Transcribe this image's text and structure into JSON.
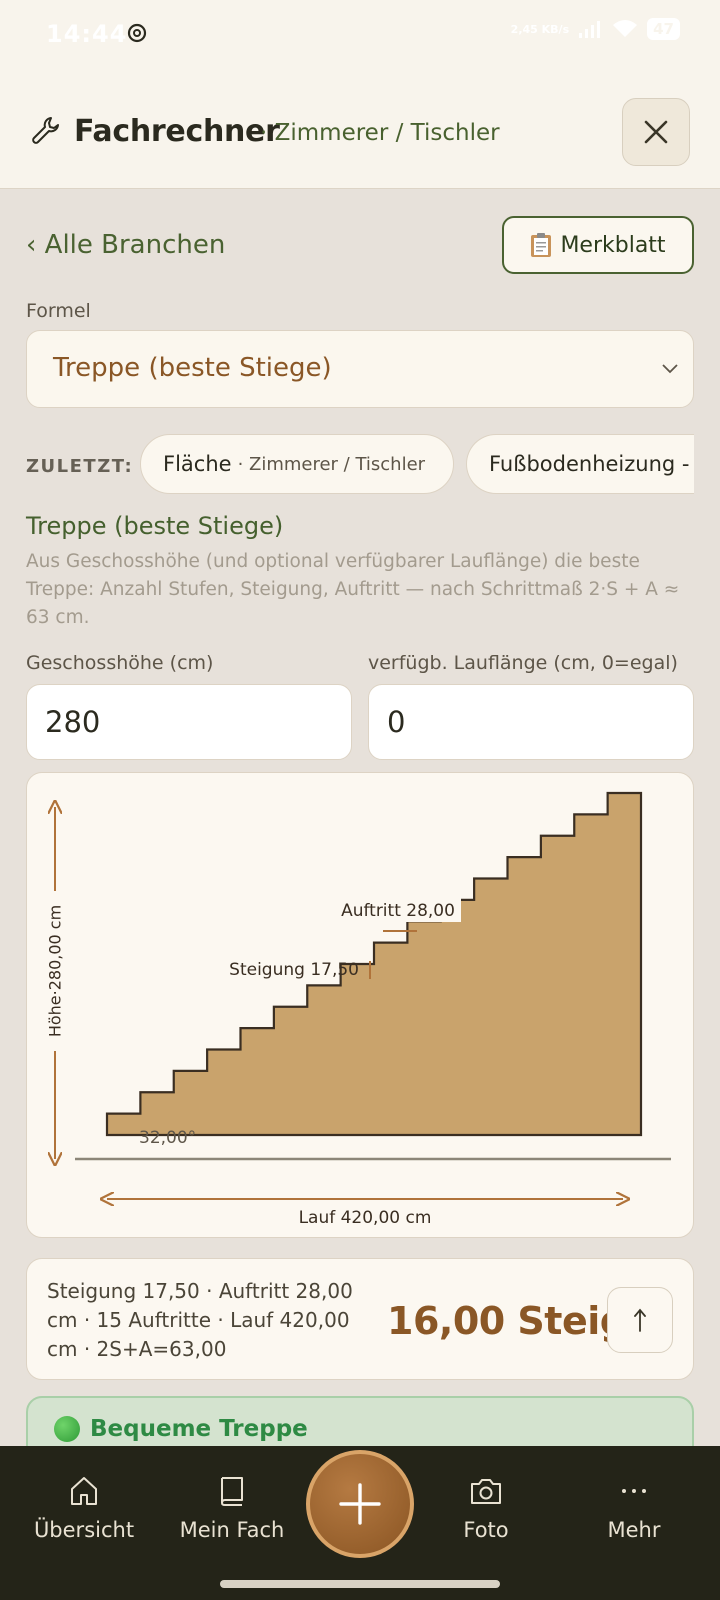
{
  "status_bar": {
    "time": "14:44",
    "net_speed": "2,45 KB/s",
    "battery": "47"
  },
  "header": {
    "title": "Fachrechner",
    "subtitle": "· Zimmerer / Tischler",
    "close_icon": "close-icon"
  },
  "nav": {
    "back_label": "‹ Alle Branchen",
    "sheet_label": "Merkblatt"
  },
  "formula": {
    "label": "Formel",
    "selected": "Treppe (beste Stiege)"
  },
  "recent": {
    "label": "ZULETZT:",
    "chips": [
      {
        "main": "Fläche",
        "sub": "· Zimmerer / Tischler"
      },
      {
        "main": "Fußbodenheizung -",
        "sub": ""
      }
    ]
  },
  "calculator": {
    "title": "Treppe (beste Stiege)",
    "description": "Aus Geschosshöhe (und optional verfügbarer Lauflänge) die beste Treppe: Anzahl Stufen, Steigung, Auftritt — nach Schrittmaß 2·S + A ≈ 63 cm.",
    "inputs": [
      {
        "label": "Geschosshöhe (cm)",
        "value": "280"
      },
      {
        "label": "verfügb. Lauflänge (cm, 0=egal)",
        "value": "0"
      }
    ]
  },
  "diagram": {
    "height_label": "Höhe·280,00 cm",
    "run_label": "Lauf 420,00 cm",
    "riser_label": "Steigung 17,50",
    "tread_label": "Auftritt 28,00",
    "angle_label": "32,00°",
    "steps": 16,
    "colors": {
      "fill": "#c9a36c",
      "stroke": "#3a2e22",
      "arrow": "#b0733a"
    }
  },
  "result": {
    "summary": "Steigung 17,50 · Auftritt 28,00 cm · 15 Auftritte · Lauf 420,00 cm · 2S+A=63,00",
    "value": "16,00 Steig."
  },
  "banner": {
    "text": "Bequeme Treppe"
  },
  "bottom_nav": {
    "items": [
      {
        "label": "Übersicht",
        "icon": "home-icon"
      },
      {
        "label": "Mein Fach",
        "icon": "book-icon"
      },
      {
        "label": "Foto",
        "icon": "camera-icon"
      },
      {
        "label": "Mehr",
        "icon": "more-icon"
      }
    ],
    "fab_icon": "plus-icon"
  }
}
